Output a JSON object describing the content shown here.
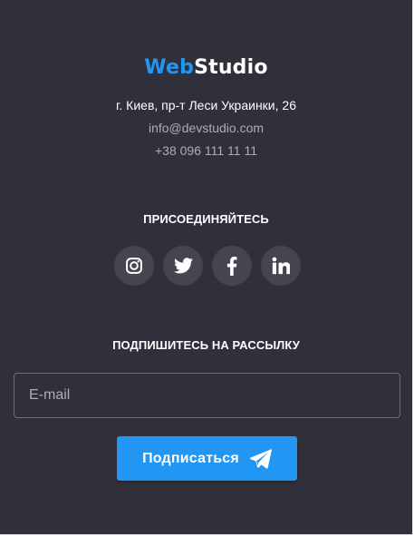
{
  "logo": {
    "accent": "Web",
    "rest": "Studio"
  },
  "contacts": {
    "address": "г. Киев, пр-т Леси Украинки, 26",
    "email": "info@devstudio.com",
    "phone": "+38 096 111 11 11"
  },
  "social": {
    "title": "ПРИСОЕДИНЯЙТЕСЬ",
    "items": [
      {
        "icon": "instagram-icon"
      },
      {
        "icon": "twitter-icon"
      },
      {
        "icon": "facebook-icon"
      },
      {
        "icon": "linkedin-icon"
      }
    ]
  },
  "subscribe": {
    "title": "ПОДПИШИТЕСЬ НА РАССЫЛКУ",
    "input_placeholder": "E-mail",
    "button_label": "Подписаться",
    "button_icon": "send-icon"
  },
  "colors": {
    "background": "#2f303a",
    "accent": "#2196f3",
    "text": "#ffffff"
  }
}
